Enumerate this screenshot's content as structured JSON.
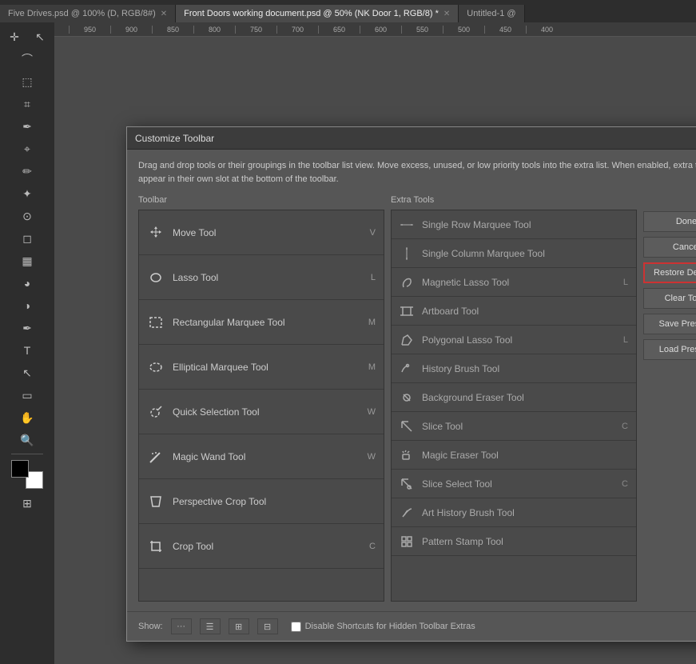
{
  "tabs": [
    {
      "label": "Five Drives.psd @ 100% (D, RGB/8#)",
      "active": false
    },
    {
      "label": "Front Doors working document.psd @ 50% (NK Door 1, RGB/8) *",
      "active": true
    },
    {
      "label": "Untitled-1 @",
      "active": false
    }
  ],
  "dialog": {
    "title": "Customize Toolbar",
    "description": "Drag and drop tools or their groupings in the toolbar list view. Move excess, unused, or low priority tools into the extra list. When enabled, extra tools will appear in their own slot at the bottom of the toolbar.",
    "toolbar_label": "Toolbar",
    "extra_tools_label": "Extra Tools",
    "toolbar_items": [
      {
        "name": "Move Tool",
        "shortcut": "V",
        "icon": "✛"
      },
      {
        "name": "Lasso Tool",
        "shortcut": "L",
        "icon": "○"
      },
      {
        "name": "Rectangular Marquee Tool",
        "shortcut": "M",
        "icon": "⬜"
      },
      {
        "name": "Elliptical Marquee Tool",
        "shortcut": "M",
        "icon": "○"
      },
      {
        "name": "Quick Selection Tool",
        "shortcut": "W",
        "icon": "⌖"
      },
      {
        "name": "Magic Wand Tool",
        "shortcut": "W",
        "icon": "✦"
      },
      {
        "name": "Perspective Crop Tool",
        "shortcut": "",
        "icon": "⧉"
      },
      {
        "name": "Crop Tool",
        "shortcut": "C",
        "icon": "⌗"
      }
    ],
    "extra_tools_items": [
      {
        "name": "Single Row Marquee Tool",
        "shortcut": "",
        "icon": "─"
      },
      {
        "name": "Single Column Marquee Tool",
        "shortcut": "",
        "icon": "│"
      },
      {
        "name": "Magnetic Lasso Tool",
        "shortcut": "L",
        "icon": "⟳"
      },
      {
        "name": "Artboard Tool",
        "shortcut": "",
        "icon": "⬜"
      },
      {
        "name": "Polygonal Lasso Tool",
        "shortcut": "L",
        "icon": "⟳"
      },
      {
        "name": "History Brush Tool",
        "shortcut": "",
        "icon": "⌖"
      },
      {
        "name": "Background Eraser Tool",
        "shortcut": "",
        "icon": "◈"
      },
      {
        "name": "Slice Tool",
        "shortcut": "C",
        "icon": "⌗"
      },
      {
        "name": "Magic Eraser Tool",
        "shortcut": "",
        "icon": "◈"
      },
      {
        "name": "Slice Select Tool",
        "shortcut": "C",
        "icon": "⌗"
      },
      {
        "name": "Art History Brush Tool",
        "shortcut": "",
        "icon": "⌖"
      },
      {
        "name": "Pattern Stamp Tool",
        "shortcut": "",
        "icon": "⌖"
      }
    ],
    "buttons": {
      "done": "Done",
      "cancel": "Cancel",
      "restore_defaults": "Restore Defaults",
      "clear_tools": "Clear Tools",
      "save_preset": "Save Preset...",
      "load_preset": "Load Preset..."
    },
    "bottom": {
      "show_label": "Show:",
      "disable_checkbox_label": "Disable Shortcuts for Hidden Toolbar Extras"
    }
  },
  "ruler_marks": [
    "950",
    "900",
    "850",
    "800",
    "750",
    "700",
    "650",
    "600",
    "550",
    "500",
    "450",
    "400"
  ]
}
